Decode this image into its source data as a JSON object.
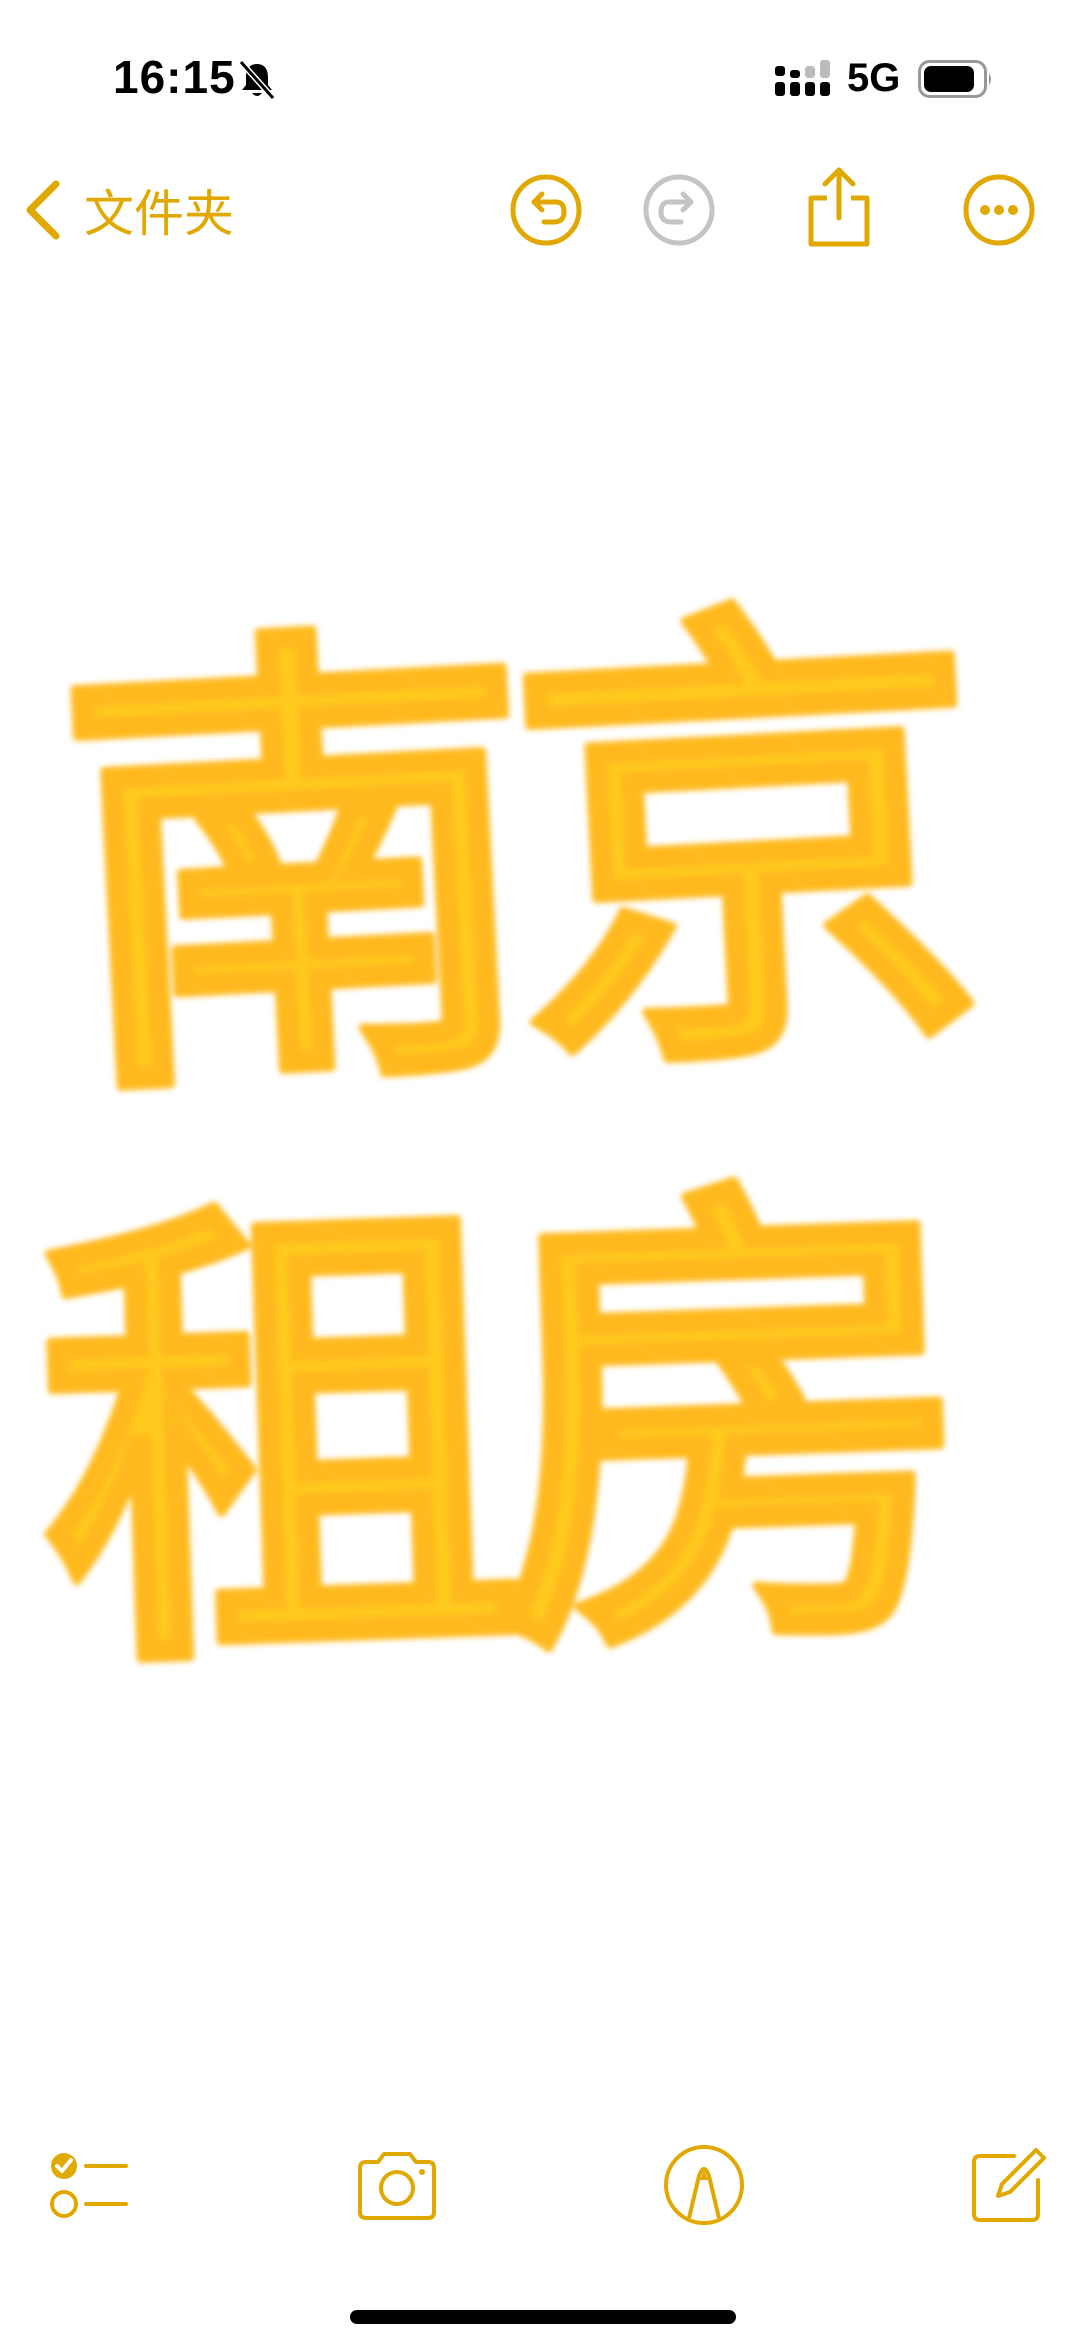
{
  "status_bar": {
    "time": "16:15",
    "network": "5G",
    "silent_mode": true
  },
  "nav": {
    "back_label": "文件夹"
  },
  "note": {
    "handwriting_line1": "南京",
    "handwriting_line2": "租房",
    "ink_color": "#FFC300"
  },
  "colors": {
    "accent": "#E0A800",
    "disabled": "#C4C4C4",
    "background": "#FFFFFF"
  },
  "icons": {
    "back": "chevron-left-icon",
    "undo": "undo-icon",
    "redo": "redo-icon",
    "share": "share-icon",
    "more": "ellipsis-icon",
    "checklist": "checklist-icon",
    "camera": "camera-icon",
    "markup": "pen-tip-icon",
    "compose": "compose-icon"
  }
}
